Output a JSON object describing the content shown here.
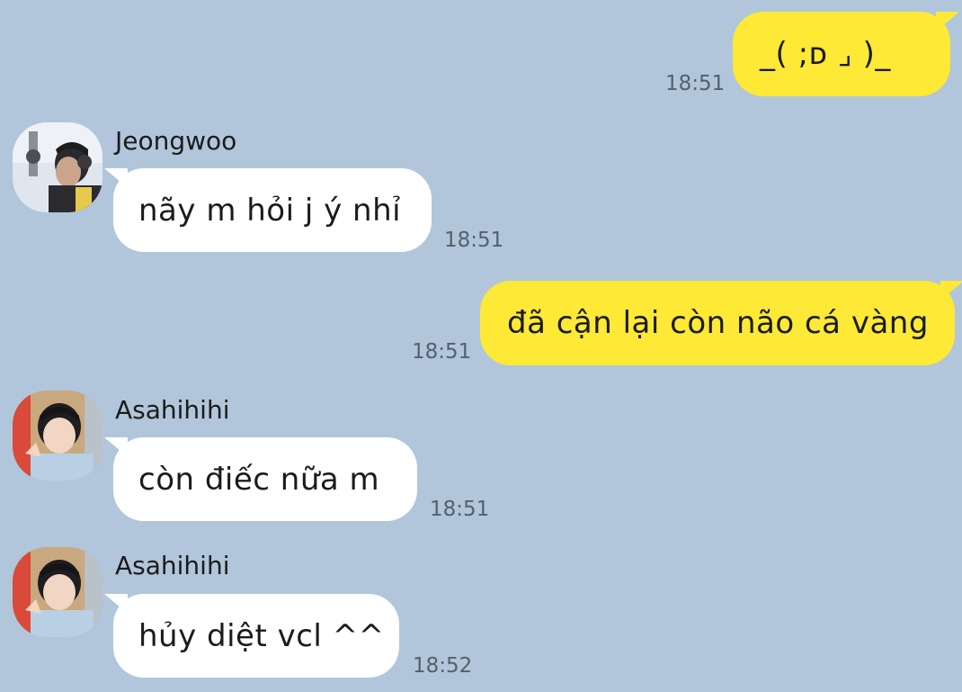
{
  "messages": [
    {
      "direction": "out",
      "text": "_( ;ᴅ ⌟ )_",
      "time": "18:51"
    },
    {
      "direction": "in",
      "sender": "Jeongwoo",
      "avatar_icon": "avatar-jeongwoo-photo-icon",
      "text": "nãy m hỏi j ý nhỉ",
      "time": "18:51"
    },
    {
      "direction": "out",
      "text": "đã cận lại còn não cá vàng",
      "time": "18:51"
    },
    {
      "direction": "in",
      "sender": "Asahihihi",
      "avatar_icon": "avatar-asahi-photo-icon",
      "text": "còn điếc nữa m",
      "time": "18:51"
    },
    {
      "direction": "in",
      "sender": "Asahihihi",
      "avatar_icon": "avatar-asahi-photo-icon",
      "text": "hủy diệt vcl ^^",
      "time": "18:52"
    }
  ],
  "colors": {
    "background": "#b1c6db",
    "outgoing_bubble": "#fde936",
    "incoming_bubble": "#ffffff",
    "timestamp": "#55606b"
  }
}
